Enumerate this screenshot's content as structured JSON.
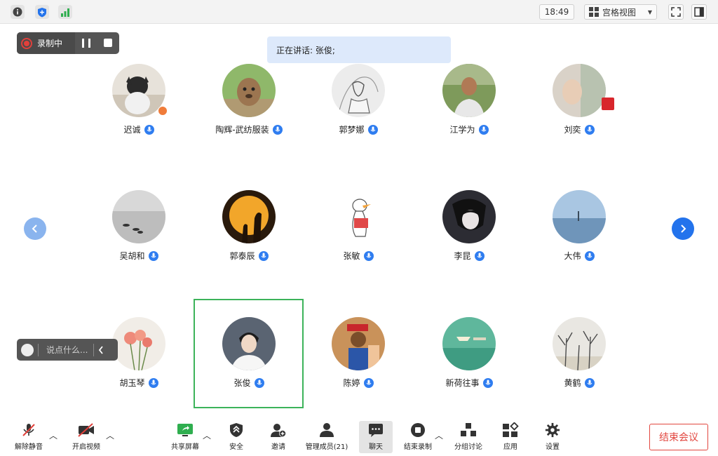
{
  "topbar": {
    "time": "18:49",
    "view_label": "宫格视图"
  },
  "recording": {
    "label": "录制中"
  },
  "speaking": {
    "text": "正在讲话: 张俊;"
  },
  "participants": [
    {
      "name": "迟诚"
    },
    {
      "name": "陶辉-武纺服装"
    },
    {
      "name": "郭梦娜"
    },
    {
      "name": "江学为"
    },
    {
      "name": "刘奕"
    },
    {
      "name": "吴胡和"
    },
    {
      "name": "郭泰辰"
    },
    {
      "name": "张敏"
    },
    {
      "name": "李昆"
    },
    {
      "name": "大伟"
    },
    {
      "name": "胡玉琴"
    },
    {
      "name": "张俊"
    },
    {
      "name": "陈婷"
    },
    {
      "name": "新荷往事"
    },
    {
      "name": "黄鹤"
    }
  ],
  "chat": {
    "placeholder": "说点什么..."
  },
  "toolbar": {
    "unmute": "解除静音",
    "start_video": "开启视频",
    "share_screen": "共享屏幕",
    "security": "安全",
    "invite": "邀请",
    "manage": "管理成员(21)",
    "chat": "聊天",
    "end_recording": "结束录制",
    "breakout": "分组讨论",
    "apps": "应用",
    "settings": "设置",
    "end_meeting": "结束会议"
  },
  "colors": {
    "accent": "#2373ec",
    "active_speaker": "#3cb35a",
    "end": "#e2463f",
    "recording": "#e0403b"
  }
}
